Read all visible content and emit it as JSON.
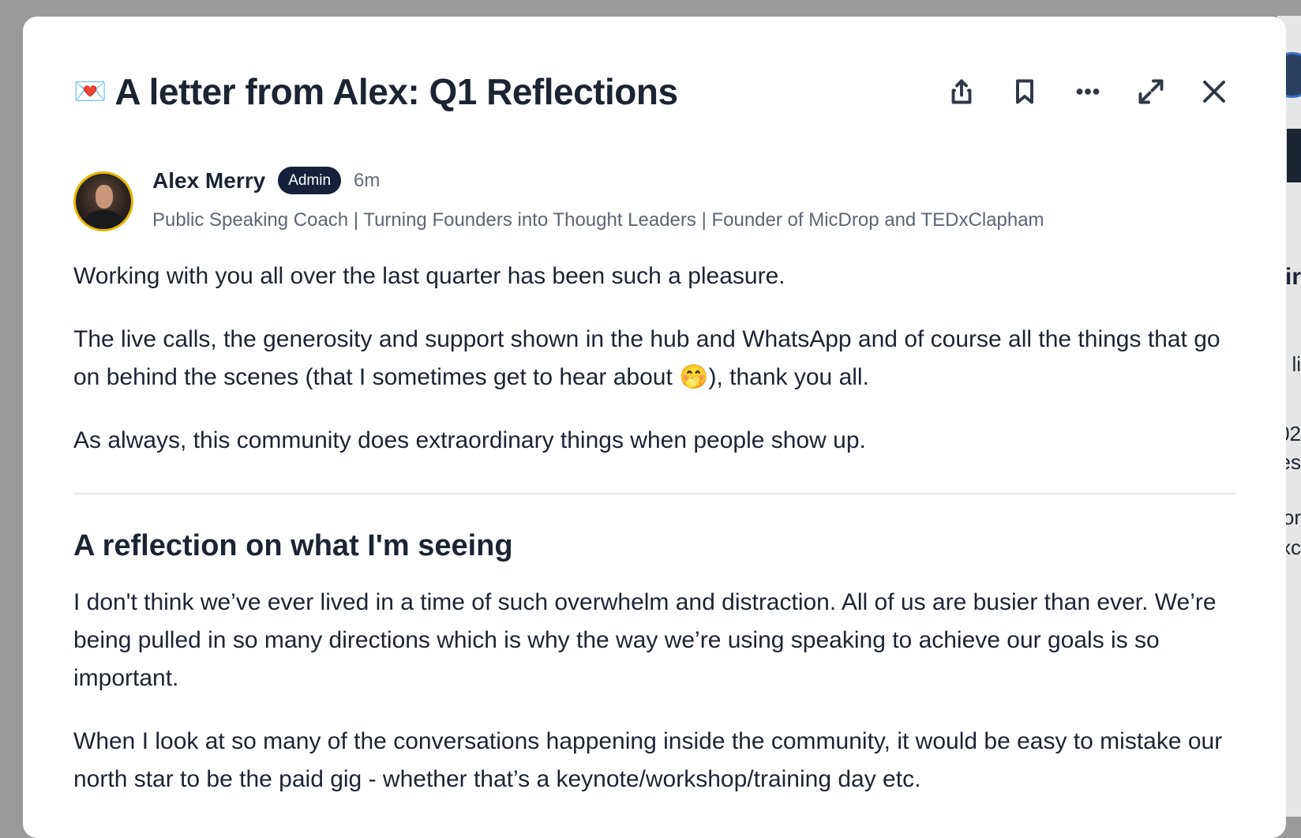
{
  "post": {
    "title_emoji": "💌",
    "title": "A letter from Alex: Q1 Reflections",
    "author": {
      "name": "Alex Merry",
      "badge": "Admin",
      "time": "6m",
      "headline": "Public Speaking Coach | Turning Founders into Thought Leaders | Founder of MicDrop and TEDxClapham"
    },
    "paragraphs": [
      "Working with you all over the last quarter has been such a pleasure.",
      "The live calls, the generosity and support shown in the hub and WhatsApp and of course all the things that go on behind the scenes (that I sometimes get to hear about 🤭), thank you all.",
      "As always, this community does extraordinary things when people show up."
    ],
    "section_heading": "A reflection on what I'm seeing",
    "section_paragraphs": [
      "I don't think we’ve ever lived in a time of such overwhelm and distraction. All of us are busier than ever. We’re being pulled in so many directions which is why the way we’re using speaking to achieve our goals is so important.",
      "When I look at so many of the conversations happening inside the community, it would be easy to mistake our north star to be the paid gig - whether that’s a keynote/workshop/training day etc."
    ]
  },
  "toolbar": {
    "icons": [
      "share-icon",
      "bookmark-icon",
      "more-icon",
      "expand-icon",
      "close-icon"
    ]
  },
  "background": {
    "fragments": [
      "ir",
      "li",
      "02",
      "es",
      "or",
      "xc"
    ]
  }
}
